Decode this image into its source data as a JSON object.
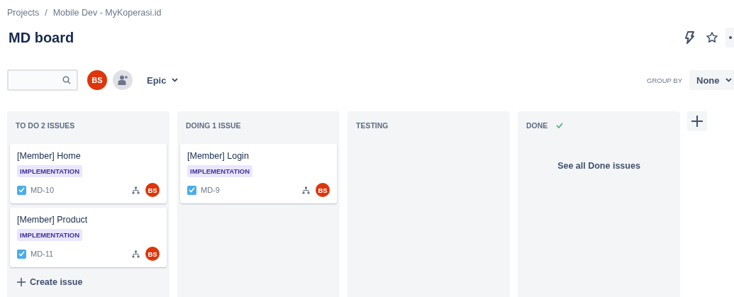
{
  "breadcrumbs": [
    "Projects",
    "Mobile Dev - MyKoperasi.id"
  ],
  "breadcrumb_separator": "/",
  "title": "MD board",
  "toolbar": {
    "avatars": [
      {
        "initials": "BS",
        "kind": "user"
      },
      {
        "kind": "add"
      }
    ],
    "epic_filter": "Epic",
    "group_by": {
      "label": "GROUP BY",
      "value": "None"
    }
  },
  "columns": [
    {
      "title": "TO DO 2 ISSUES",
      "done": false,
      "create_action": "Create issue",
      "cards": [
        {
          "title": "[Member] Home",
          "label": "IMPLEMENTATION",
          "key": "MD-10",
          "checked": true,
          "assignee": "BS"
        },
        {
          "title": "[Member] Product",
          "label": "IMPLEMENTATION",
          "key": "MD-11",
          "checked": true,
          "assignee": "BS"
        }
      ]
    },
    {
      "title": "DOING 1 ISSUE",
      "done": false,
      "cards": [
        {
          "title": "[Member] Login",
          "label": "IMPLEMENTATION",
          "key": "MD-9",
          "checked": true,
          "assignee": "BS"
        }
      ]
    },
    {
      "title": "TESTING",
      "done": false
    },
    {
      "title": "DONE",
      "done": true,
      "footer_link": "See all Done issues"
    }
  ]
}
